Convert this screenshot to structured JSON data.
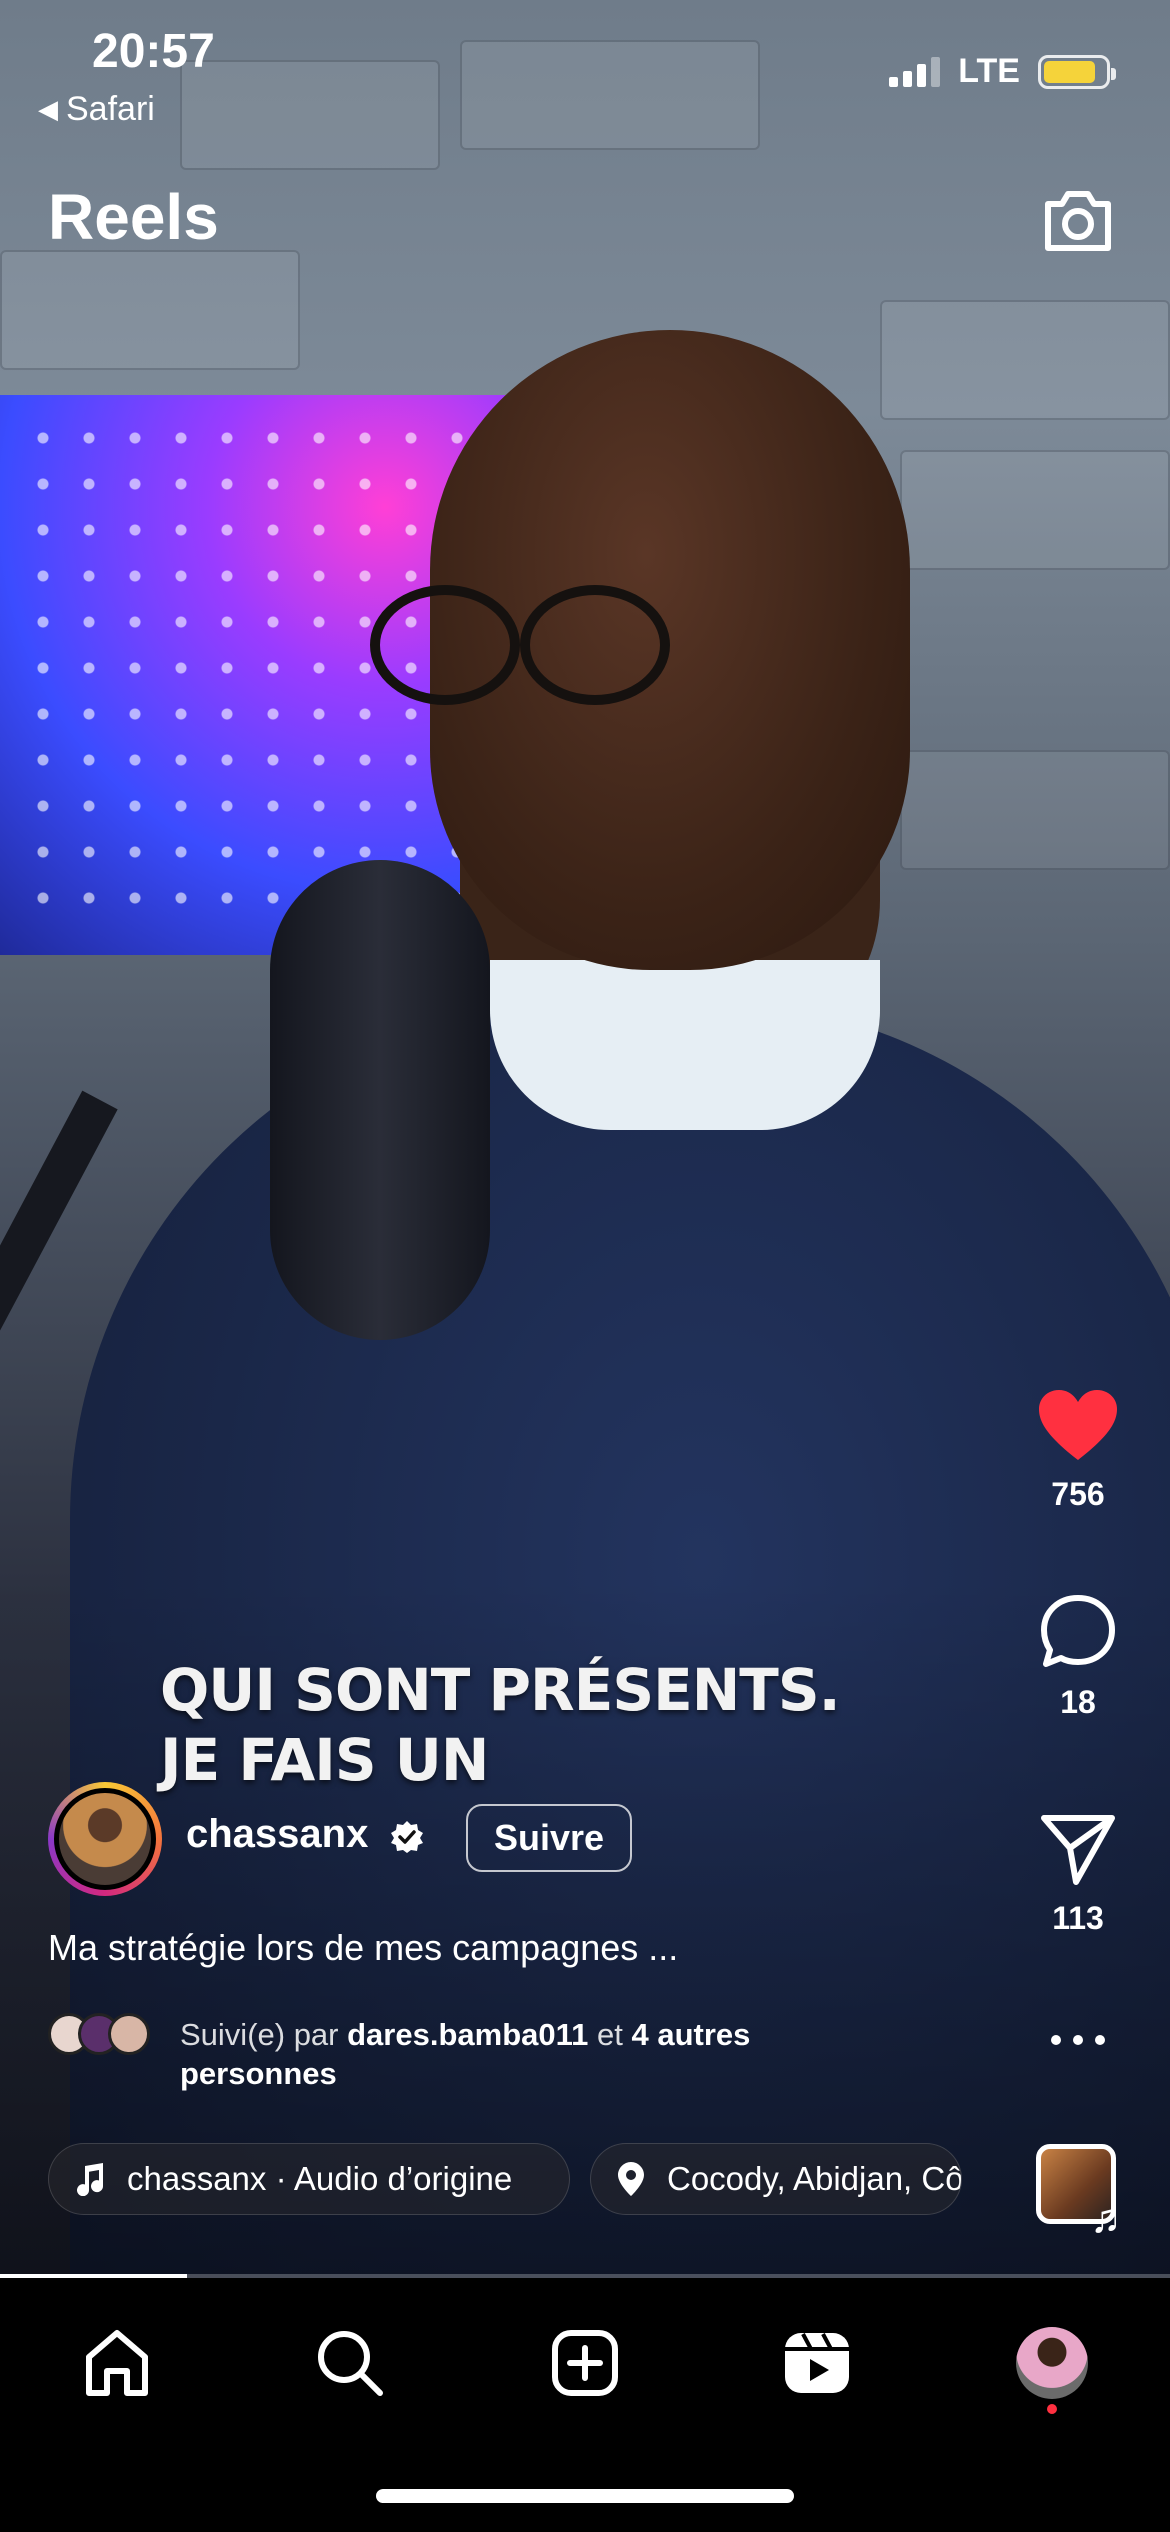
{
  "status_bar": {
    "time": "20:57",
    "back_app": "Safari",
    "network": "LTE",
    "battery_level": 0.85,
    "battery_color": "#f5d33a"
  },
  "header": {
    "title": "Reels",
    "camera_icon": "camera-icon"
  },
  "video": {
    "overlay_lines": [
      "QUI SONT PRÉSENTS.",
      "JE FAIS UN"
    ],
    "progress": 0.16
  },
  "actions": {
    "like": {
      "icon": "heart-icon",
      "count": "756",
      "color": "#ff3040",
      "liked": true
    },
    "comment": {
      "icon": "comment-icon",
      "count": "18"
    },
    "share": {
      "icon": "paper-plane-icon",
      "count": "113"
    },
    "more": {
      "icon": "more-horizontal-icon"
    }
  },
  "creator": {
    "username": "chassanx",
    "verified": true,
    "follow_label": "Suivre"
  },
  "caption": "Ma stratégie lors de mes campagnes ...",
  "followed_by": {
    "prefix": "Suivi(e) par",
    "user": "dares.bamba011",
    "joiner": "et",
    "others": "4 autres",
    "others_suffix": "personnes"
  },
  "audio": {
    "label": "chassanx · Audio d’origine"
  },
  "location": {
    "label": "Cocody, Abidjan, Côte d'Ivoire"
  },
  "tabbar": {
    "items": [
      "home-icon",
      "search-icon",
      "create-icon",
      "reels-icon",
      "profile-avatar"
    ],
    "notification_dot_color": "#ff3040"
  }
}
